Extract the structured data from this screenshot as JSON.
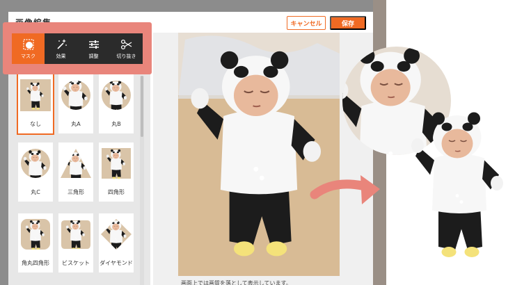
{
  "dialog": {
    "title": "画像編集",
    "cancel_label": "キャンセル",
    "save_label": "保存"
  },
  "toolbar": {
    "tools": [
      {
        "label": "マスク",
        "icon": "mask-icon",
        "active": true
      },
      {
        "label": "効果",
        "icon": "magic-wand-icon",
        "active": false
      },
      {
        "label": "調整",
        "icon": "sliders-icon",
        "active": false
      },
      {
        "label": "切り抜き",
        "icon": "scissors-icon",
        "active": false
      }
    ]
  },
  "masks": [
    {
      "label": "なし",
      "shape": "none",
      "selected": true
    },
    {
      "label": "丸A",
      "shape": "circle-a",
      "selected": false
    },
    {
      "label": "丸B",
      "shape": "circle-b",
      "selected": false
    },
    {
      "label": "丸C",
      "shape": "circle-c",
      "selected": false
    },
    {
      "label": "三角形",
      "shape": "triangle",
      "selected": false
    },
    {
      "label": "四角形",
      "shape": "square",
      "selected": false
    },
    {
      "label": "角丸四角形",
      "shape": "rounded-square",
      "selected": false
    },
    {
      "label": "ビスケット",
      "shape": "biscuit",
      "selected": false
    },
    {
      "label": "ダイヤモンド",
      "shape": "diamond",
      "selected": false
    }
  ],
  "footnote": "画面上では画質を落として表示しています。",
  "colors": {
    "accent": "#f06a23",
    "highlight": "#e9857b",
    "toolbar_bg": "#2b2b2b"
  }
}
